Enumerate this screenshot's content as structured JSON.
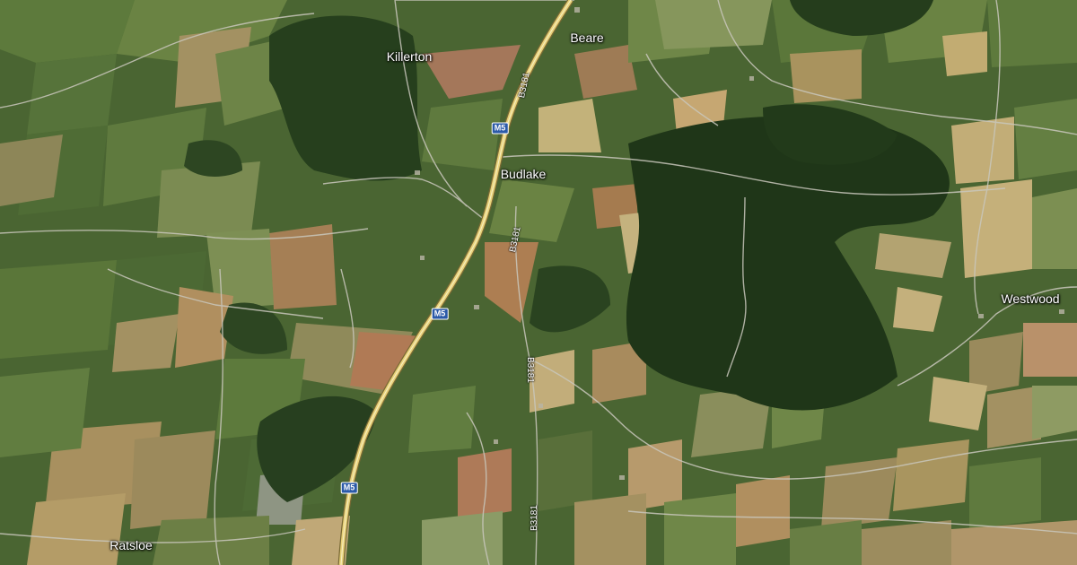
{
  "places": {
    "killerton": "Killerton",
    "beare": "Beare",
    "budlake": "Budlake",
    "westwood": "Westwood",
    "ratsloe": "Ratsloe"
  },
  "roads": {
    "m5": "M5",
    "b3181": "B3181"
  },
  "colors": {
    "field_dark": "#3f5a2c",
    "field_mid": "#5f7a3e",
    "field_light": "#7d8f54",
    "field_tan": "#a39162",
    "field_brown": "#9c7652",
    "woodland": "#223a1a",
    "road_minor": "#c9c7bc",
    "motorway": "#e8d27a",
    "shield": "#2b5aa8"
  }
}
